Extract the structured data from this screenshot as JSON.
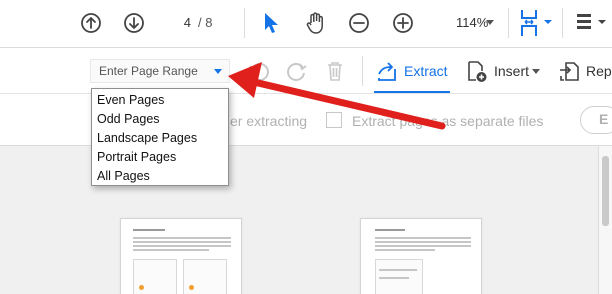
{
  "toolbar": {
    "current_page": "4",
    "page_separator": "/ 8",
    "zoom": "114%",
    "icons": [
      "prev-page-icon",
      "next-page-icon",
      "select-cursor-icon",
      "hand-tool-icon",
      "zoom-out-icon",
      "zoom-in-icon",
      "fit-page-icon",
      "page-view-icon"
    ]
  },
  "organize_bar": {
    "page_range_placeholder": "Enter Page Range",
    "extract_label": "Extract",
    "insert_label": "Insert",
    "replace_label": "Repl"
  },
  "options_row": {
    "delete_after_label": "er extracting",
    "separate_files_label": "Extract pages as separate files",
    "extract_button_label": "E"
  },
  "page_range_menu": {
    "items": [
      "Even Pages",
      "Odd Pages",
      "Landscape Pages",
      "Portrait Pages",
      "All Pages"
    ]
  },
  "colors": {
    "accent": "#1473e6",
    "annotation_arrow": "#e0201c"
  }
}
